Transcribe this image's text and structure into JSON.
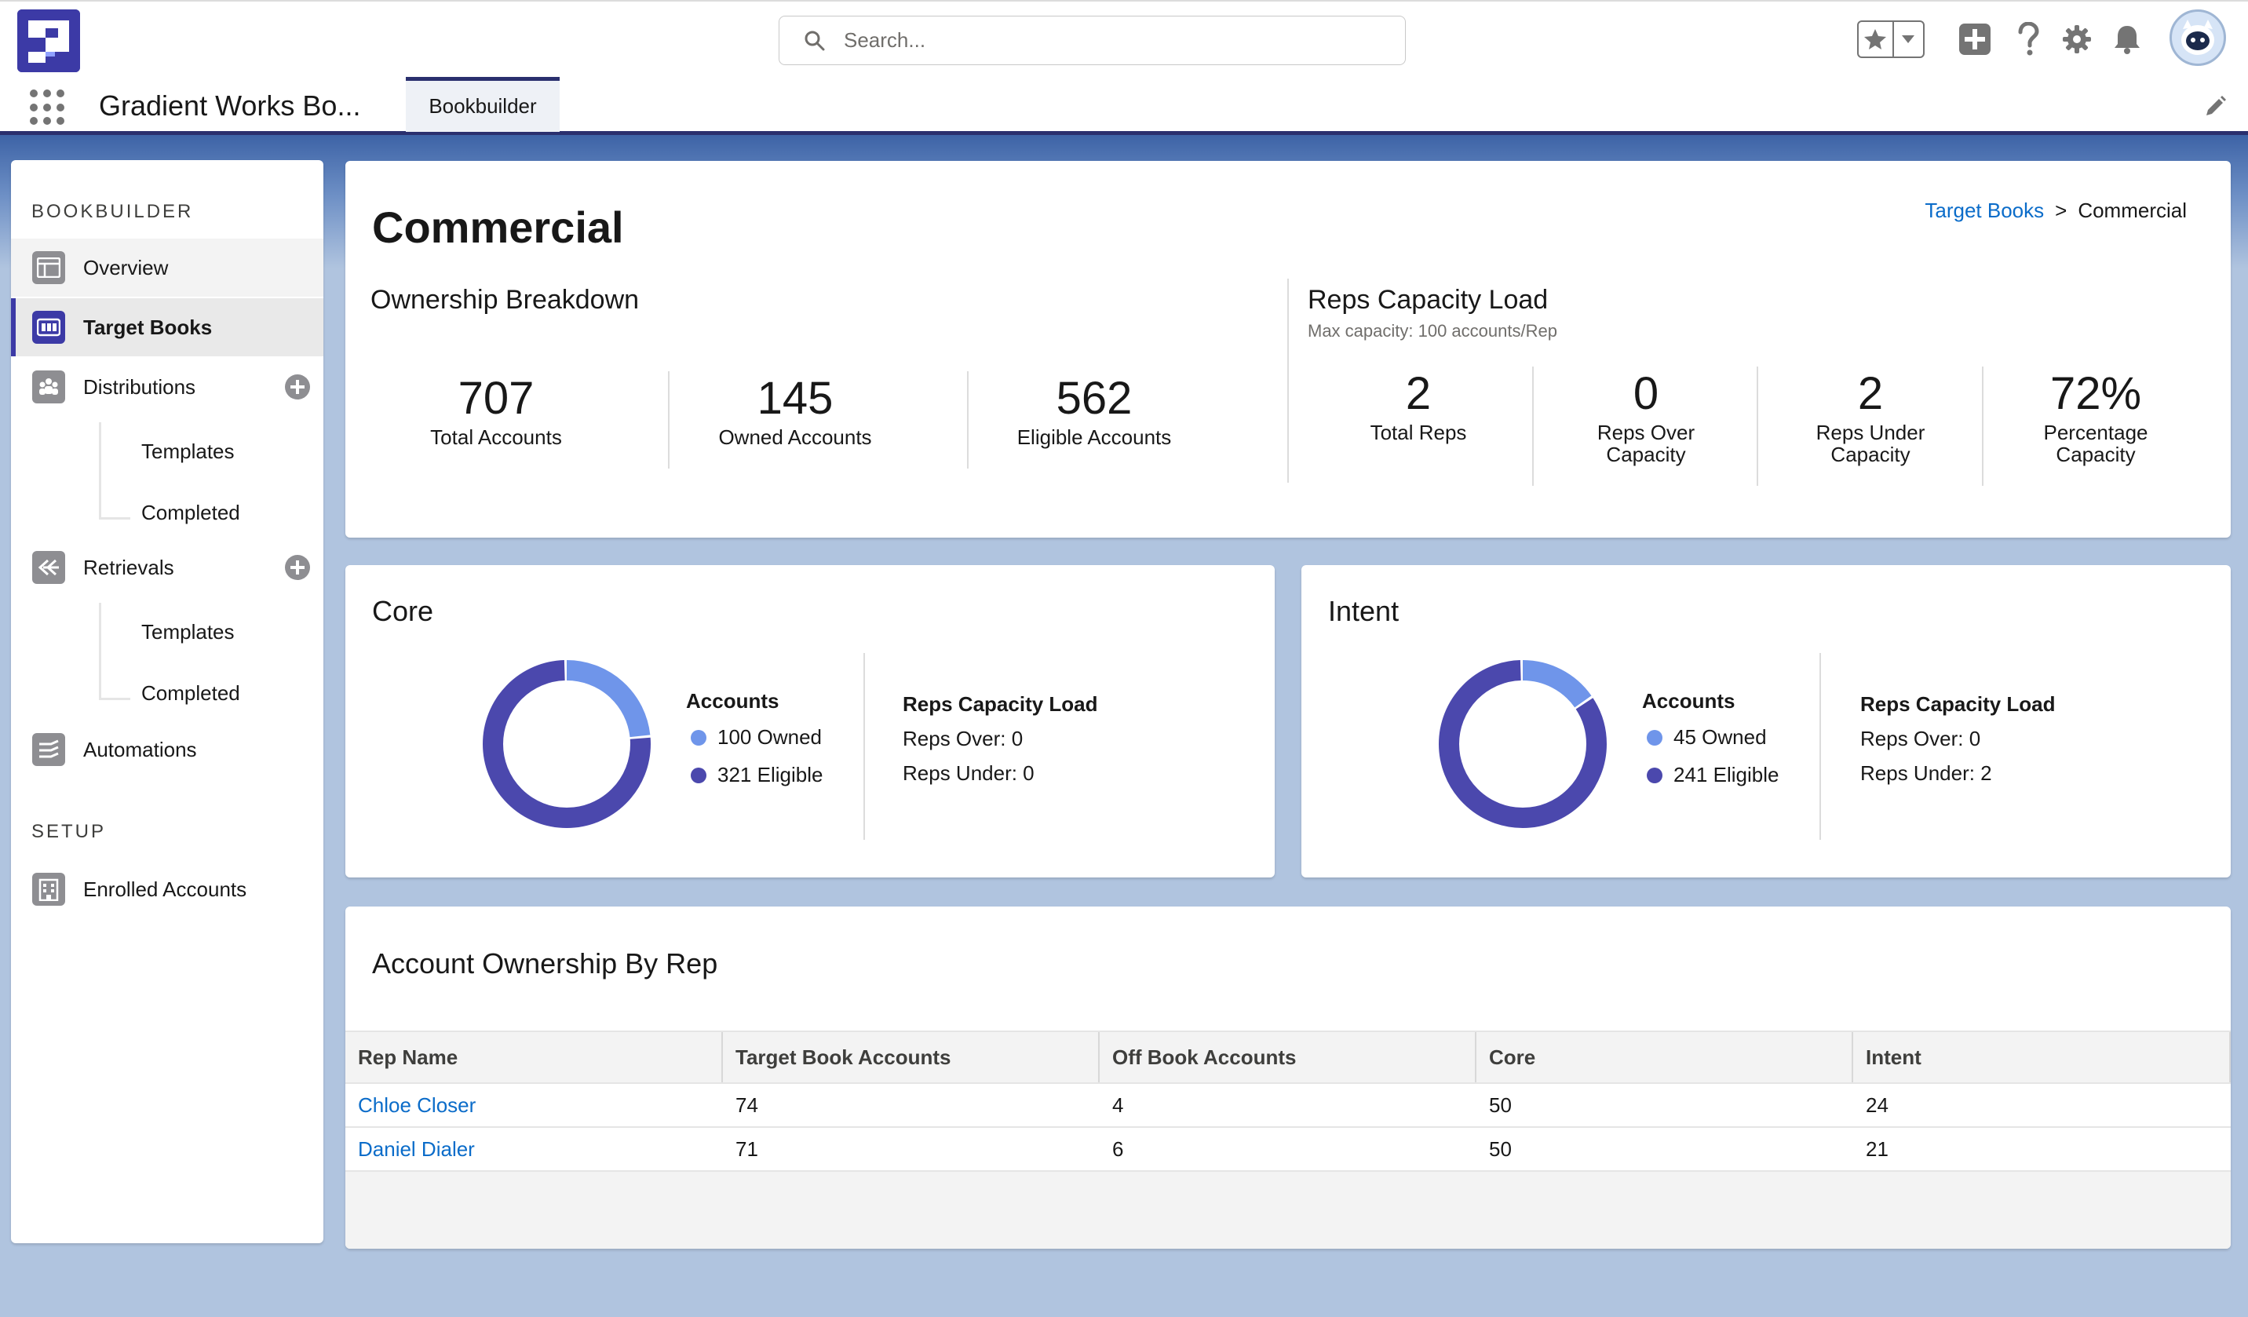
{
  "header": {
    "search_placeholder": "Search..."
  },
  "nav": {
    "app_name": "Gradient Works Bo...",
    "tab_label": "Bookbuilder"
  },
  "sidebar": {
    "section_bookbuilder": "BOOKBUILDER",
    "section_setup": "SETUP",
    "items": {
      "overview": "Overview",
      "target_books": "Target Books",
      "distributions": "Distributions",
      "distributions_templates": "Templates",
      "distributions_completed": "Completed",
      "retrievals": "Retrievals",
      "retrievals_templates": "Templates",
      "retrievals_completed": "Completed",
      "automations": "Automations",
      "enrolled_accounts": "Enrolled Accounts"
    }
  },
  "page": {
    "title": "Commercial",
    "breadcrumb": {
      "parent": "Target Books",
      "separator": ">",
      "current": "Commercial"
    }
  },
  "ownership": {
    "heading": "Ownership Breakdown",
    "stats": [
      {
        "value": "707",
        "label": "Total Accounts"
      },
      {
        "value": "145",
        "label": "Owned Accounts"
      },
      {
        "value": "562",
        "label": "Eligible Accounts"
      }
    ]
  },
  "capacity": {
    "heading": "Reps Capacity Load",
    "subheading": "Max capacity: 100 accounts/Rep",
    "stats": [
      {
        "value": "2",
        "label_1": "Total Reps",
        "label_2": ""
      },
      {
        "value": "0",
        "label_1": "Reps Over",
        "label_2": "Capacity"
      },
      {
        "value": "2",
        "label_1": "Reps Under",
        "label_2": "Capacity"
      },
      {
        "value": "72%",
        "label_1": "Percentage",
        "label_2": "Capacity"
      }
    ]
  },
  "segments": [
    {
      "title": "Core",
      "accounts_label": "Accounts",
      "owned": 100,
      "owned_label": "100 Owned",
      "eligible": 321,
      "eligible_label": "321 Eligible",
      "capacity_label": "Reps Capacity Load",
      "reps_over": "Reps Over: 0",
      "reps_under": "Reps Under: 0"
    },
    {
      "title": "Intent",
      "accounts_label": "Accounts",
      "owned": 45,
      "owned_label": "45 Owned",
      "eligible": 241,
      "eligible_label": "241 Eligible",
      "capacity_label": "Reps Capacity Load",
      "reps_over": "Reps Over: 0",
      "reps_under": "Reps Under: 2"
    }
  ],
  "colors": {
    "owned": "#6f95ea",
    "eligible": "#4b48ad",
    "brand": "#3c3aa6",
    "link": "#0b6cc9"
  },
  "table": {
    "title": "Account Ownership By Rep",
    "headers": [
      "Rep Name",
      "Target Book Accounts",
      "Off Book Accounts",
      "Core",
      "Intent"
    ],
    "rows": [
      [
        "Chloe Closer",
        "74",
        "4",
        "50",
        "24"
      ],
      [
        "Daniel Dialer",
        "71",
        "6",
        "50",
        "21"
      ]
    ]
  },
  "icons": {
    "search": "search-icon",
    "favorites": "star-icon",
    "add": "plus-icon",
    "help": "question-icon",
    "settings": "gear-icon",
    "notifications": "bell-icon",
    "avatar": "astro-avatar",
    "app_launcher": "waffle-icon",
    "edit_nav": "pencil-icon"
  }
}
